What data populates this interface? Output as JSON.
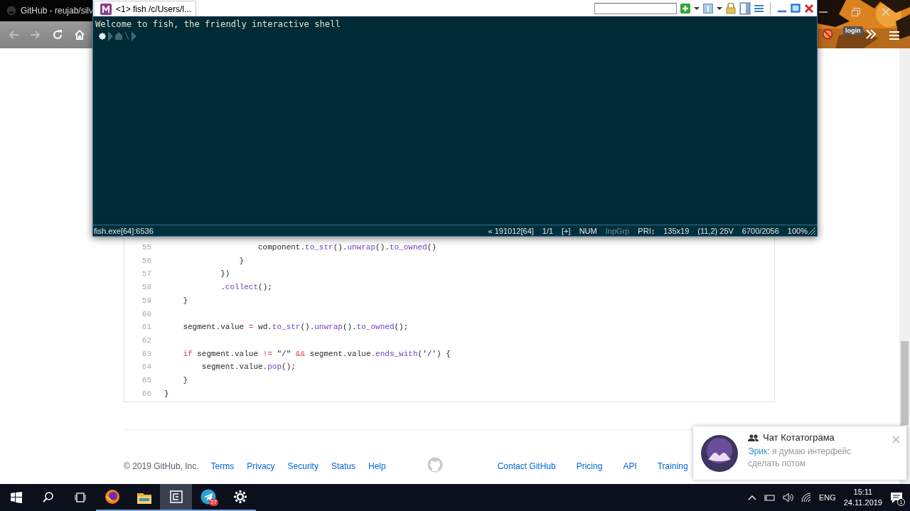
{
  "browser": {
    "tab_title": "GitHub - reujab/silv",
    "nav_buttons": [
      {
        "kind": "back",
        "disabled": true
      },
      {
        "kind": "forward",
        "disabled": true
      },
      {
        "kind": "reload",
        "disabled": false
      },
      {
        "kind": "home",
        "disabled": false
      }
    ],
    "extension_label": "login"
  },
  "code": {
    "lines": [
      {
        "number": "55",
        "tokens": [
          {
            "kind": "plain",
            "text": "                    component."
          },
          {
            "kind": "method",
            "text": "to_str"
          },
          {
            "kind": "plain",
            "text": "()."
          },
          {
            "kind": "method",
            "text": "unwrap"
          },
          {
            "kind": "plain",
            "text": "()."
          },
          {
            "kind": "method",
            "text": "to_owned"
          },
          {
            "kind": "plain",
            "text": "()"
          }
        ]
      },
      {
        "number": "56",
        "tokens": [
          {
            "kind": "plain",
            "text": "                }"
          }
        ]
      },
      {
        "number": "57",
        "tokens": [
          {
            "kind": "plain",
            "text": "            })"
          }
        ]
      },
      {
        "number": "58",
        "tokens": [
          {
            "kind": "plain",
            "text": "            ."
          },
          {
            "kind": "method",
            "text": "collect"
          },
          {
            "kind": "plain",
            "text": "();"
          }
        ]
      },
      {
        "number": "59",
        "tokens": [
          {
            "kind": "plain",
            "text": "    }"
          }
        ]
      },
      {
        "number": "60"
      },
      {
        "number": "61",
        "tokens": [
          {
            "kind": "plain",
            "text": "    segment.value "
          },
          {
            "kind": "keyword",
            "text": "="
          },
          {
            "kind": "plain",
            "text": " wd."
          },
          {
            "kind": "method",
            "text": "to_str"
          },
          {
            "kind": "plain",
            "text": "()."
          },
          {
            "kind": "method",
            "text": "unwrap"
          },
          {
            "kind": "plain",
            "text": "()."
          },
          {
            "kind": "method",
            "text": "to_owned"
          },
          {
            "kind": "plain",
            "text": "();"
          }
        ]
      },
      {
        "number": "62"
      },
      {
        "number": "63",
        "tokens": [
          {
            "kind": "keyword",
            "text": "    if"
          },
          {
            "kind": "plain",
            "text": " segment.value "
          },
          {
            "kind": "keyword",
            "text": "!="
          },
          {
            "kind": "string",
            "text": " \"/\" "
          },
          {
            "kind": "keyword",
            "text": "&&"
          },
          {
            "kind": "plain",
            "text": " segment.value."
          },
          {
            "kind": "method",
            "text": "ends_with"
          },
          {
            "kind": "plain",
            "text": "("
          },
          {
            "kind": "string",
            "text": "'/'"
          },
          {
            "kind": "plain",
            "text": ") {"
          }
        ]
      },
      {
        "number": "64",
        "tokens": [
          {
            "kind": "plain",
            "text": "        segment.value."
          },
          {
            "kind": "method",
            "text": "pop"
          },
          {
            "kind": "plain",
            "text": "();"
          }
        ]
      },
      {
        "number": "65",
        "tokens": [
          {
            "kind": "plain",
            "text": "    }"
          }
        ]
      },
      {
        "number": "66",
        "tokens": [
          {
            "kind": "plain",
            "text": "}"
          }
        ]
      }
    ]
  },
  "footer": {
    "copyright": "© 2019 GitHub, Inc.",
    "links_left": [
      "Terms",
      "Privacy",
      "Security",
      "Status",
      "Help"
    ],
    "links_right": [
      "Contact GitHub",
      "Pricing",
      "API",
      "Training"
    ]
  },
  "terminal": {
    "tab_title": "<1> fish /c/Users/l...",
    "console_lines": [
      "Welcome to fish, the friendly interactive shell"
    ],
    "prompt": {
      "cwd": "\\"
    },
    "status": {
      "process": "fish.exe[64]:6536",
      "segments": [
        {
          "text": "« 191012[64]",
          "disabled": false
        },
        {
          "text": "1/1",
          "disabled": false
        },
        {
          "text": "[+]",
          "disabled": false
        },
        {
          "text": "NUM",
          "disabled": false
        },
        {
          "text": "InpGrp",
          "disabled": true
        },
        {
          "text": "PRI↕",
          "disabled": false
        },
        {
          "text": "135x19",
          "disabled": false
        },
        {
          "text": "(11,2) 25V",
          "disabled": false
        },
        {
          "text": "6700/2056",
          "disabled": false
        },
        {
          "text": "100%",
          "disabled": false
        }
      ]
    }
  },
  "notification": {
    "title": "Чат Котатограма",
    "sender": "Эрик:",
    "message": "я думаю интерфейс сделать потом"
  },
  "taskbar": {
    "apps": [
      {
        "kind": "start",
        "running": false,
        "selected": false
      },
      {
        "kind": "search",
        "running": false,
        "selected": false
      },
      {
        "kind": "task-view",
        "running": false,
        "selected": false
      },
      {
        "kind": "firefox",
        "running": true,
        "selected": false
      },
      {
        "kind": "files",
        "running": true,
        "selected": false
      },
      {
        "kind": "terminal",
        "running": true,
        "selected": true
      },
      {
        "kind": "telegram",
        "running": true,
        "selected": false,
        "badge": "27"
      },
      {
        "kind": "settings",
        "running": true,
        "selected": false
      }
    ],
    "language": "ENG",
    "time": "15:11",
    "date": "24.11.2019",
    "notifications": "1"
  }
}
